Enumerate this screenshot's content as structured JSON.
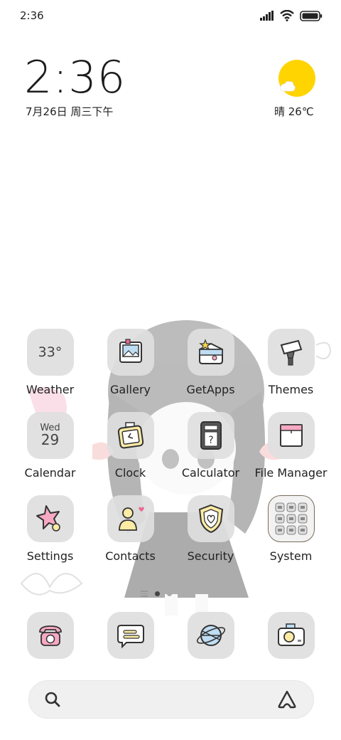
{
  "status_bar": {
    "time": "2:36"
  },
  "clock": {
    "time": "2:36",
    "date": "7月26日 周三下午"
  },
  "weather": {
    "condition_temp": "晴 26℃"
  },
  "apps": [
    {
      "label": "Weather",
      "icon": "weather-icon",
      "value": "33°"
    },
    {
      "label": "Gallery",
      "icon": "gallery-icon"
    },
    {
      "label": "GetApps",
      "icon": "getapps-icon"
    },
    {
      "label": "Themes",
      "icon": "themes-icon"
    },
    {
      "label": "Calendar",
      "icon": "calendar-icon",
      "day": "Wed",
      "date": "29"
    },
    {
      "label": "Clock",
      "icon": "clock-icon"
    },
    {
      "label": "Calculator",
      "icon": "calculator-icon"
    },
    {
      "label": "File Manager",
      "icon": "file-manager-icon"
    },
    {
      "label": "Settings",
      "icon": "settings-icon"
    },
    {
      "label": "Contacts",
      "icon": "contacts-icon"
    },
    {
      "label": "Security",
      "icon": "security-icon"
    },
    {
      "label": "System",
      "icon": "system-folder-icon"
    }
  ],
  "dock": [
    {
      "icon": "phone-icon"
    },
    {
      "icon": "messages-icon"
    },
    {
      "icon": "browser-icon"
    },
    {
      "icon": "camera-icon"
    }
  ],
  "page_indicator": {
    "pages": 2,
    "active": 0
  },
  "colors": {
    "sun": "#FFD400",
    "icon_bg": "#DEDEDE",
    "pink": "#F7A8C4",
    "yellow": "#FBEBA5",
    "blue": "#BFDDF2"
  }
}
